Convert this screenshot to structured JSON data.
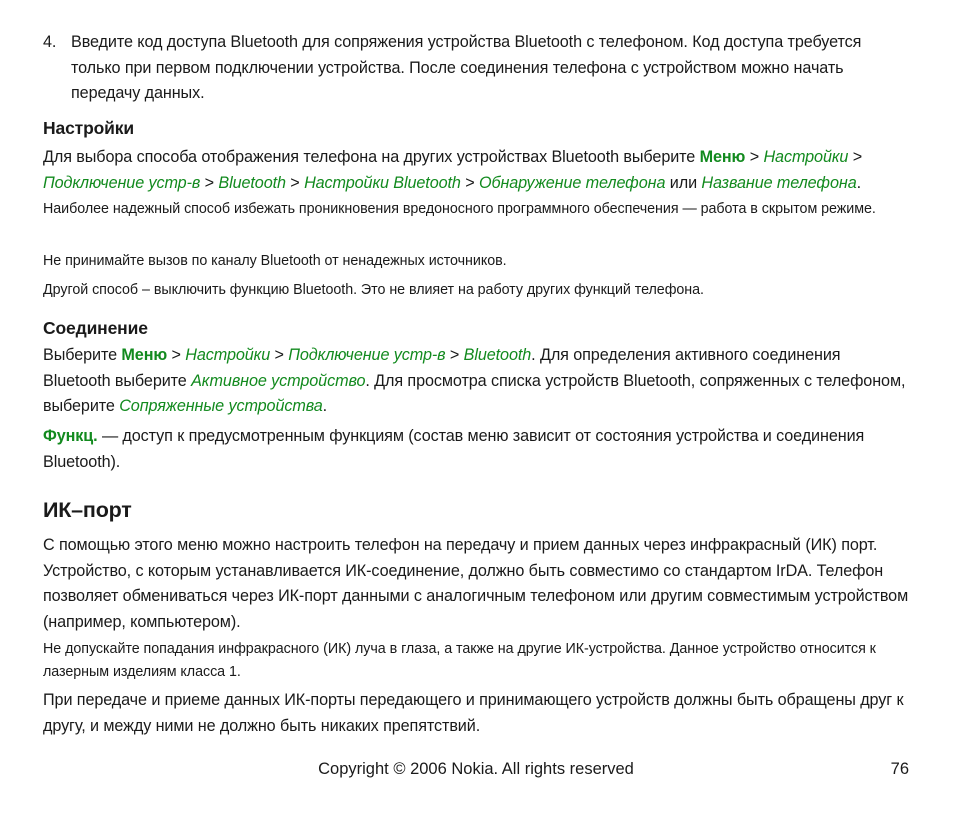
{
  "colors": {
    "accent_green": "#128a1e",
    "text": "#1a1a1a",
    "background": "#ffffff"
  },
  "list": {
    "marker": "4.",
    "text": "Введите код доступа Bluetooth для сопряжения устройства Bluetooth с телефоном. Код доступа требуется только при первом подключении устройства. После соединения телефона с устройством можно начать передачу данных."
  },
  "settings_section": {
    "heading": "Настройки",
    "path_para": {
      "lead": "Для выбора способа отображения телефона на других устройствах Bluetooth выберите ",
      "menu": "Меню",
      "sep1": " > ",
      "item1": "Настройки",
      "sep2": " > ",
      "item2": "Подключение устр-в",
      "sep3": " > ",
      "item3": "Bluetooth",
      "sep4": " > ",
      "item4": "Настройки Bluetooth",
      "sep5": " > ",
      "item5": "Обнаружение телефона",
      "conjunction": " или ",
      "item6": "Название телефона",
      "tail": "."
    },
    "note1": "Наиболее надежный способ избежать проникновения вредоносного программного обеспечения — работа в скрытом режиме.",
    "note2": "Не принимайте вызов по каналу Bluetooth от ненадежных источников.",
    "note3": "Другой способ –  выключить функцию Bluetooth. Это не влияет на работу других функций телефона."
  },
  "connection_section": {
    "heading": "Соединение",
    "path_para": {
      "lead": "Выберите ",
      "menu": "Меню",
      "sep1": " > ",
      "item1": "Настройки",
      "sep2": " > ",
      "item2": "Подключение устр-в",
      "sep3": " > ",
      "item3": "Bluetooth",
      "mid1": ". Для определения активного соединения Bluetooth выберите ",
      "item4": "Активное устройство",
      "mid2": ". Для просмотра списка устройств Bluetooth, сопряженных с телефоном, выберите ",
      "item5": "Сопряженные устройства",
      "tail": "."
    },
    "options_para": {
      "label": "Функц.",
      "text": " — доступ к предусмотренным функциям (состав меню зависит от состояния устройства и соединения Bluetooth)."
    }
  },
  "ir_section": {
    "heading": "ИК–порт",
    "body": "С помощью этого меню можно настроить телефон на передачу и прием данных через инфракрасный (ИК) порт. Устройство, с которым устанавливается ИК-соединение, должно быть совместимо со стандартом IrDA. Телефон позволяет обмениваться через ИК-порт данными с аналогичным телефоном или другим совместимым устройством (например, компьютером).",
    "warning": "Не допускайте попадания инфракрасного (ИК) луча в глаза, а также на другие ИК-устройства. Данное устройство относится к лазерным изделиям класса 1.",
    "closing": "При передаче и приеме данных ИК-порты передающего и принимающего устройств должны быть обращены друг к другу, и между ними не должно быть никаких препятствий."
  },
  "footer": {
    "copyright": "Copyright © 2006 Nokia. All rights reserved",
    "page_number": "76"
  }
}
